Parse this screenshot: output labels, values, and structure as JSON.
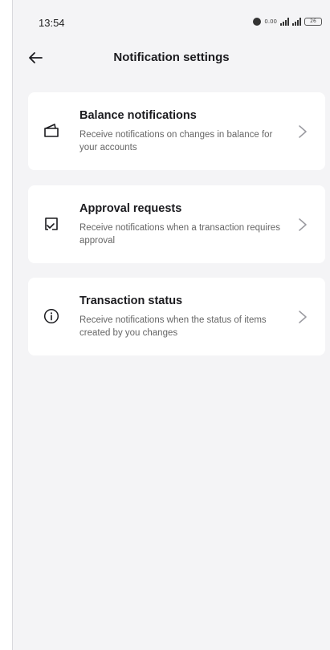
{
  "status_bar": {
    "time": "13:54",
    "network_speed": "0.00",
    "battery": "26"
  },
  "header": {
    "title": "Notification settings",
    "back_icon": "arrow-left-icon"
  },
  "settings": [
    {
      "icon": "wallet-icon",
      "title": "Balance notifications",
      "description": "Receive notifications on changes in balance for your accounts"
    },
    {
      "icon": "approval-icon",
      "title": "Approval requests",
      "description": "Receive notifications when a transaction requires approval"
    },
    {
      "icon": "info-icon",
      "title": "Transaction status",
      "description": "Receive notifications when the status of items created by you changes"
    }
  ],
  "colors": {
    "background": "#f4f4f6",
    "card": "#ffffff",
    "title": "#1b1b1f",
    "description": "#666666"
  }
}
